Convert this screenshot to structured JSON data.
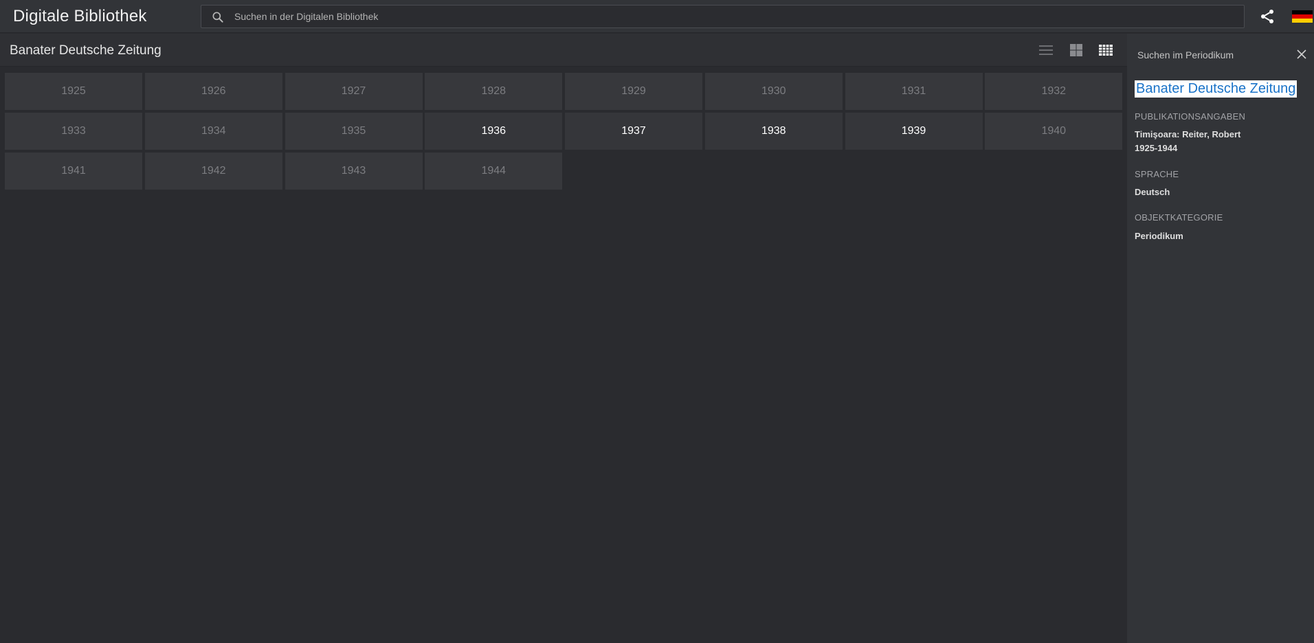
{
  "app": {
    "title": "Digitale Bibliothek"
  },
  "search": {
    "placeholder": "Suchen in der Digitalen Bibliothek",
    "value": ""
  },
  "header_actions": {
    "share_icon": "share-icon",
    "language_flag": "de-flag-icon",
    "flag_colors": [
      "#000000",
      "#dd0000",
      "#ffce00"
    ]
  },
  "main": {
    "title": "Banater Deutsche Zeitung",
    "views": [
      {
        "name": "list-view",
        "active": false
      },
      {
        "name": "tile-view",
        "active": false
      },
      {
        "name": "grid-view",
        "active": true
      }
    ],
    "years": [
      {
        "label": "1925",
        "available": false
      },
      {
        "label": "1926",
        "available": false
      },
      {
        "label": "1927",
        "available": false
      },
      {
        "label": "1928",
        "available": false
      },
      {
        "label": "1929",
        "available": false
      },
      {
        "label": "1930",
        "available": false
      },
      {
        "label": "1931",
        "available": false
      },
      {
        "label": "1932",
        "available": false
      },
      {
        "label": "1933",
        "available": false
      },
      {
        "label": "1934",
        "available": false
      },
      {
        "label": "1935",
        "available": false
      },
      {
        "label": "1936",
        "available": true
      },
      {
        "label": "1937",
        "available": true
      },
      {
        "label": "1938",
        "available": true
      },
      {
        "label": "1939",
        "available": true
      },
      {
        "label": "1940",
        "available": false
      },
      {
        "label": "1941",
        "available": false
      },
      {
        "label": "1942",
        "available": false
      },
      {
        "label": "1943",
        "available": false
      },
      {
        "label": "1944",
        "available": false
      }
    ]
  },
  "side_panel": {
    "search_label": "Suchen im Periodikum",
    "title": "Banater Deutsche Zeitung",
    "title_color": "#1a73c8",
    "publication_label": "PUBLIKATIONSANGABEN",
    "publication_line1": "Timişoara: Reiter, Robert",
    "publication_line2": "1925-1944",
    "language_label": "SPRACHE",
    "language_value": "Deutsch",
    "category_label": "OBJEKTKATEGORIE",
    "category_value": "Periodikum"
  }
}
